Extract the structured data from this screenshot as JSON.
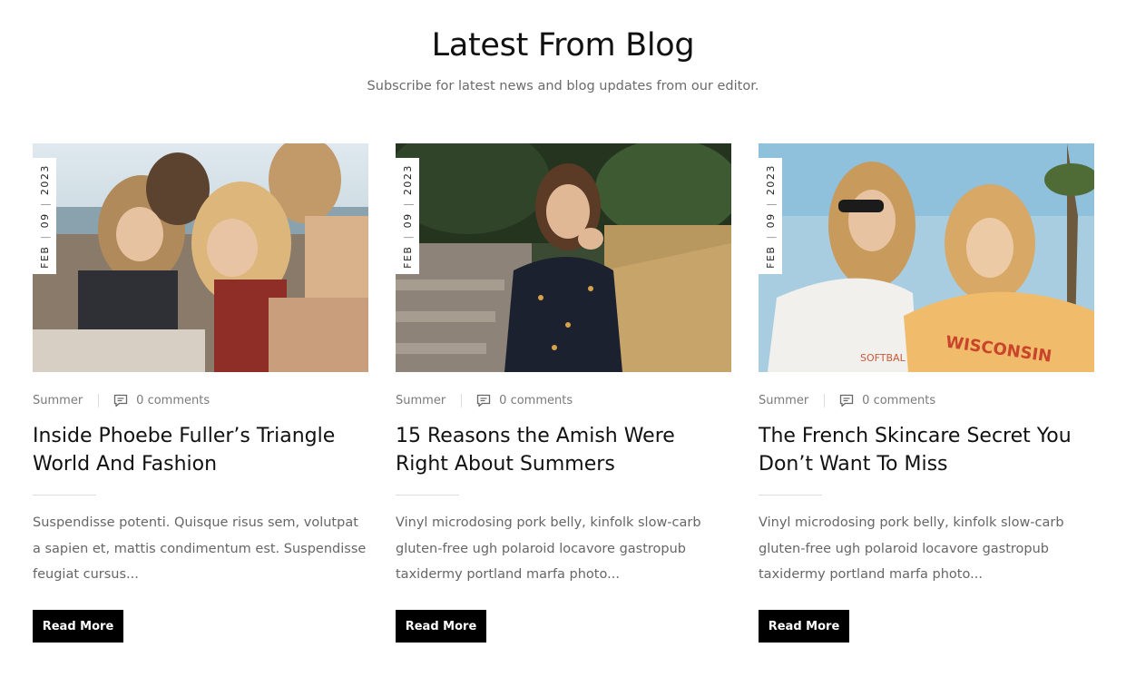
{
  "section": {
    "title": "Latest From Blog",
    "subtitle": "Subscribe for latest news and blog updates from our editor."
  },
  "posts": [
    {
      "date": {
        "month": "FEB",
        "day": "09",
        "year": "2023"
      },
      "category": "Summer",
      "comments": "0 comments",
      "title": "Inside Phoebe Fuller’s Triangle World And Fashion",
      "excerpt": "Suspendisse potenti. Quisque risus sem, volutpat a sapien et, mattis condimentum est. Suspendisse feugiat cursus...",
      "button": "Read More"
    },
    {
      "date": {
        "month": "FEB",
        "day": "09",
        "year": "2023"
      },
      "category": "Summer",
      "comments": "0 comments",
      "title": "15 Reasons the Amish Were Right About Summers",
      "excerpt": "Vinyl microdosing pork belly, kinfolk slow-carb gluten-free ugh polaroid locavore gastropub taxidermy portland marfa photo...",
      "button": "Read More"
    },
    {
      "date": {
        "month": "FEB",
        "day": "09",
        "year": "2023"
      },
      "category": "Summer",
      "comments": "0 comments",
      "title": "The French Skincare Secret You Don’t Want To Miss",
      "excerpt": "Vinyl microdosing pork belly, kinfolk slow-carb gluten-free ugh polaroid locavore gastropub taxidermy portland marfa photo...",
      "button": "Read More"
    }
  ],
  "icons": {
    "comments": "comment-icon"
  },
  "colors": {
    "button_bg": "#000000",
    "button_text": "#ffffff",
    "meta_text": "#7a7a7a"
  }
}
